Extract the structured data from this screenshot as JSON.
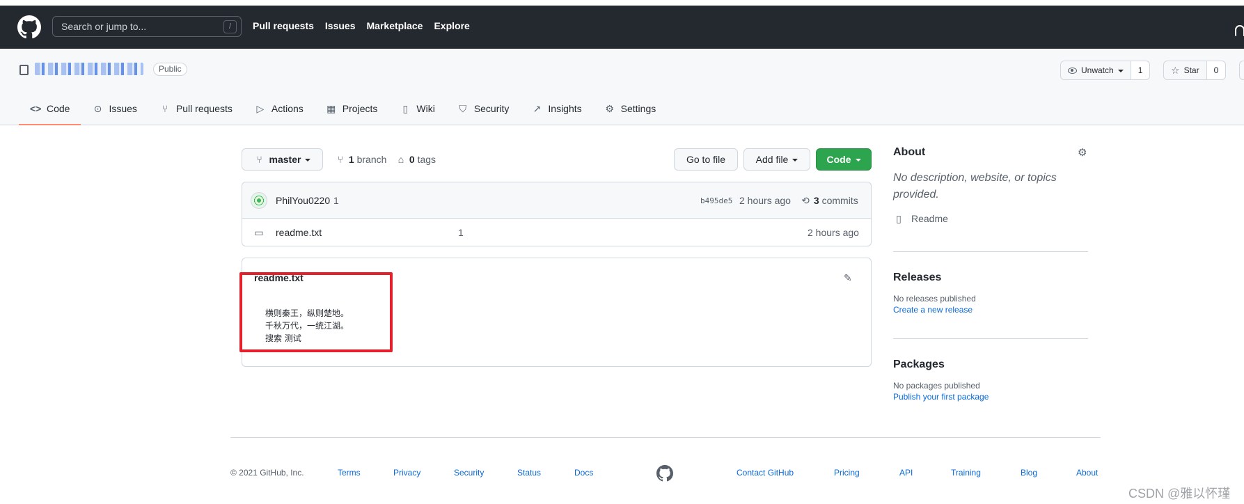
{
  "header": {
    "search_placeholder": "Search or jump to...",
    "slash_key": "/",
    "nav": [
      "Pull requests",
      "Issues",
      "Marketplace",
      "Explore"
    ]
  },
  "repo": {
    "visibility": "Public",
    "watch": {
      "label": "Unwatch",
      "count": "1"
    },
    "star": {
      "label": "Star",
      "count": "0"
    },
    "tabs": [
      {
        "label": "Code",
        "icon": "code-icon"
      },
      {
        "label": "Issues",
        "icon": "issue-icon"
      },
      {
        "label": "Pull requests",
        "icon": "pull-request-icon"
      },
      {
        "label": "Actions",
        "icon": "play-icon"
      },
      {
        "label": "Projects",
        "icon": "project-icon"
      },
      {
        "label": "Wiki",
        "icon": "book-icon"
      },
      {
        "label": "Security",
        "icon": "shield-icon"
      },
      {
        "label": "Insights",
        "icon": "graph-icon"
      },
      {
        "label": "Settings",
        "icon": "gear-icon"
      }
    ]
  },
  "branchbar": {
    "branch": "master",
    "branch_count": "1",
    "branch_word": "branch",
    "tag_count": "0",
    "tag_word": "tags",
    "go_to_file": "Go to file",
    "add_file": "Add file",
    "code": "Code"
  },
  "commit": {
    "author": "PhilYou0220",
    "message": "1",
    "sha": "b495de5",
    "time": "2 hours ago",
    "count": "3",
    "count_word": "commits"
  },
  "files": [
    {
      "name": "readme.txt",
      "message": "1",
      "time": "2 hours ago"
    }
  ],
  "readme": {
    "title": "readme.txt",
    "lines": [
      "横则秦王，纵则楚地。",
      "千秋万代，一统江湖。",
      "搜索 测试"
    ]
  },
  "sidebar": {
    "about_title": "About",
    "about_desc": "No description, website, or topics provided.",
    "readme_link": "Readme",
    "releases_title": "Releases",
    "releases_text": "No releases published",
    "releases_link": "Create a new release",
    "packages_title": "Packages",
    "packages_text": "No packages published",
    "packages_link": "Publish your first package"
  },
  "footer": {
    "copyright": "© 2021 GitHub, Inc.",
    "left_links": [
      "Terms",
      "Privacy",
      "Security",
      "Status",
      "Docs"
    ],
    "right_links": [
      "Contact GitHub",
      "Pricing",
      "API",
      "Training",
      "Blog",
      "About"
    ]
  },
  "watermark": "CSDN @雅以怀瑾",
  "colors": {
    "header_bg": "#24292f",
    "accent_green": "#2da44e",
    "link_blue": "#0969da",
    "highlight_red": "#e3212d",
    "active_tab_underline": "#fd8c73"
  }
}
